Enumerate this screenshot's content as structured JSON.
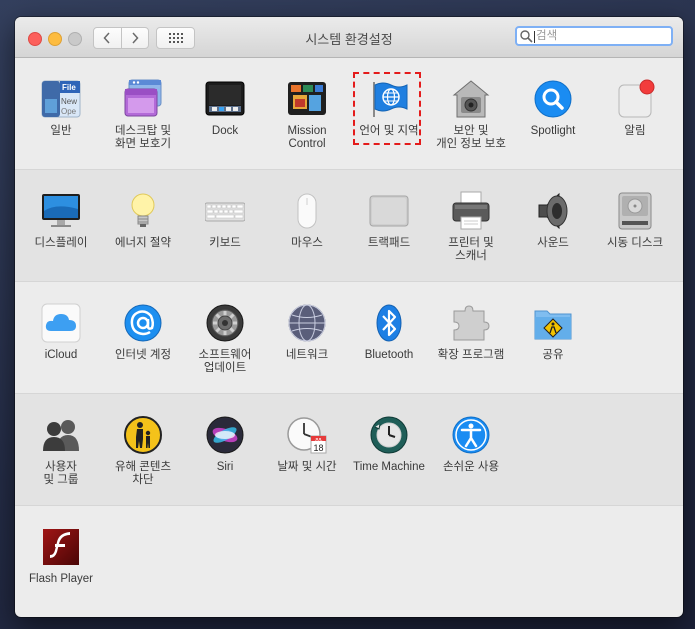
{
  "window": {
    "title": "시스템 환경설정"
  },
  "search": {
    "placeholder": "검색"
  },
  "colors": {
    "highlight": "#e41b1b",
    "accent_blue": "#1a8cf2"
  },
  "sections": [
    {
      "items": [
        {
          "label": "일반",
          "icon": "general-icon"
        },
        {
          "label": "데스크탑 및\n화면 보호기",
          "icon": "desktop-screensaver-icon"
        },
        {
          "label": "Dock",
          "icon": "dock-icon"
        },
        {
          "label": "Mission\nControl",
          "icon": "mission-control-icon"
        },
        {
          "label": "언어 및 지역",
          "icon": "language-region-icon"
        },
        {
          "label": "보안 및\n개인 정보 보호",
          "icon": "security-privacy-icon"
        },
        {
          "label": "Spotlight",
          "icon": "spotlight-icon"
        },
        {
          "label": "알림",
          "icon": "notifications-icon"
        }
      ]
    },
    {
      "items": [
        {
          "label": "디스플레이",
          "icon": "displays-icon"
        },
        {
          "label": "에너지 절약",
          "icon": "energy-saver-icon"
        },
        {
          "label": "키보드",
          "icon": "keyboard-icon"
        },
        {
          "label": "마우스",
          "icon": "mouse-icon"
        },
        {
          "label": "트랙패드",
          "icon": "trackpad-icon"
        },
        {
          "label": "프린터 및\n스캐너",
          "icon": "printers-scanners-icon"
        },
        {
          "label": "사운드",
          "icon": "sound-icon"
        },
        {
          "label": "시동 디스크",
          "icon": "startup-disk-icon"
        }
      ]
    },
    {
      "items": [
        {
          "label": "iCloud",
          "icon": "icloud-icon"
        },
        {
          "label": "인터넷 계정",
          "icon": "internet-accounts-icon"
        },
        {
          "label": "소프트웨어\n업데이트",
          "icon": "software-update-icon"
        },
        {
          "label": "네트워크",
          "icon": "network-icon"
        },
        {
          "label": "Bluetooth",
          "icon": "bluetooth-icon"
        },
        {
          "label": "확장 프로그램",
          "icon": "extensions-icon"
        },
        {
          "label": "공유",
          "icon": "sharing-icon"
        }
      ]
    },
    {
      "items": [
        {
          "label": "사용자\n및 그룹",
          "icon": "users-groups-icon"
        },
        {
          "label": "유해 콘텐츠\n차단",
          "icon": "parental-controls-icon"
        },
        {
          "label": "Siri",
          "icon": "siri-icon"
        },
        {
          "label": "날짜 및 시간",
          "icon": "date-time-icon"
        },
        {
          "label": "Time Machine",
          "icon": "time-machine-icon"
        },
        {
          "label": "손쉬운 사용",
          "icon": "accessibility-icon"
        }
      ]
    },
    {
      "items": [
        {
          "label": "Flash Player",
          "icon": "flash-player-icon"
        }
      ]
    }
  ],
  "general_icon_text": {
    "file": "File",
    "new": "New",
    "ope": "Ope"
  },
  "calendar_icon_text": {
    "month": "JUL",
    "day": "18"
  }
}
